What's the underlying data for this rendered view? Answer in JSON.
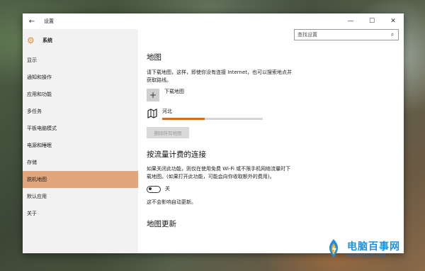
{
  "window": {
    "title": "设置"
  },
  "sidebar": {
    "header": "系统",
    "items": [
      {
        "label": "显示"
      },
      {
        "label": "通知和操作"
      },
      {
        "label": "应用和功能"
      },
      {
        "label": "多任务"
      },
      {
        "label": "平板电脑模式"
      },
      {
        "label": "电源和睡眠"
      },
      {
        "label": "存储"
      },
      {
        "label": "脱机地图",
        "selected": true
      },
      {
        "label": "默认应用"
      },
      {
        "label": "关于"
      }
    ]
  },
  "search": {
    "placeholder": "查找设置"
  },
  "maps": {
    "heading": "地图",
    "description_line1": "请下载地图，这样，即使你没有连接 Internet，也可以搜索地点并",
    "description_line2": "获取路线。",
    "download_label": "下载地图",
    "downloaded_map_name": "河北",
    "download_progress": 0.42,
    "delete_all_label": "删除所有地图"
  },
  "metered": {
    "heading": "按流量计费的连接",
    "description_line1": "如果关闭此功能，则仅在使用免费 Wi-Fi 或不限手机网络流量时下",
    "description_line2": "载地图。(如果打开此功能，可能会向你收取额外的费用)。",
    "toggle_state": "关",
    "note": "这不会影响自动更新。"
  },
  "updates": {
    "heading": "地图更新"
  },
  "watermark": {
    "name": "电脑百事网",
    "url": "WWW.PC841.COM"
  },
  "colors": {
    "accent": "#d26d1c",
    "selected_nav": "#e2a67c",
    "watermark_blue": "#1d8fe0"
  }
}
